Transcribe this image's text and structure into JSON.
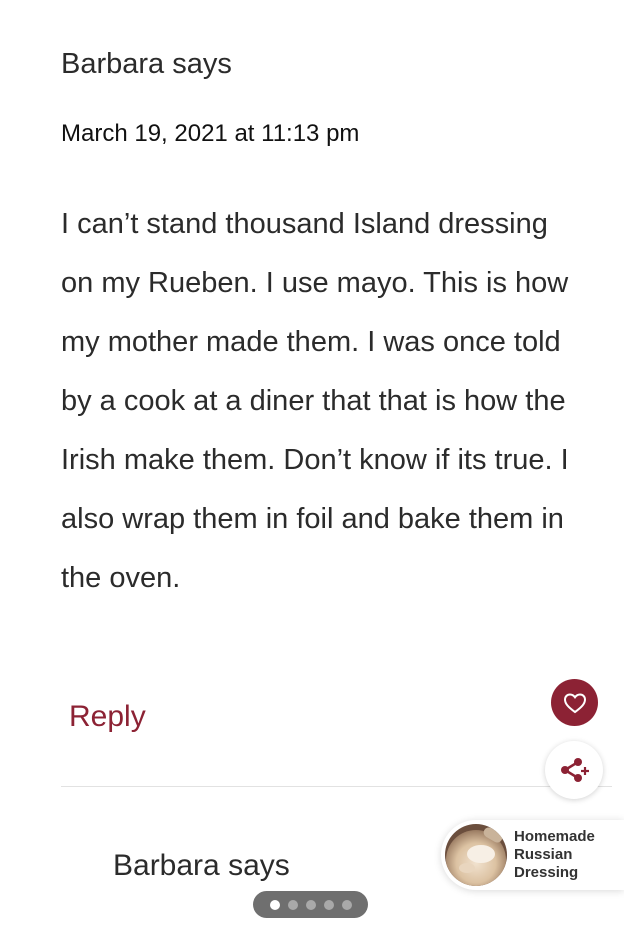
{
  "comment": {
    "author_line": "Barbara says",
    "timestamp": "March 19, 2021 at 11:13 pm",
    "body": "I can’t stand thousand Island dressing on my Rueben. I use mayo. This is how my mother made them. I was once told by a cook at a diner that that is how the Irish make them. Don’t know if its true. I also wrap them in foil and bake them in the oven.",
    "reply_label": "Reply"
  },
  "next_comment": {
    "author_line": "Barbara says"
  },
  "floating_actions": {
    "heart_icon": "heart-icon",
    "share_icon": "share-plus-icon"
  },
  "promo": {
    "title": "Homemade Russian Dressing"
  },
  "pager": {
    "total": 5,
    "active_index": 0
  },
  "colors": {
    "accent": "#8c2234",
    "text": "#2b2b2b"
  }
}
